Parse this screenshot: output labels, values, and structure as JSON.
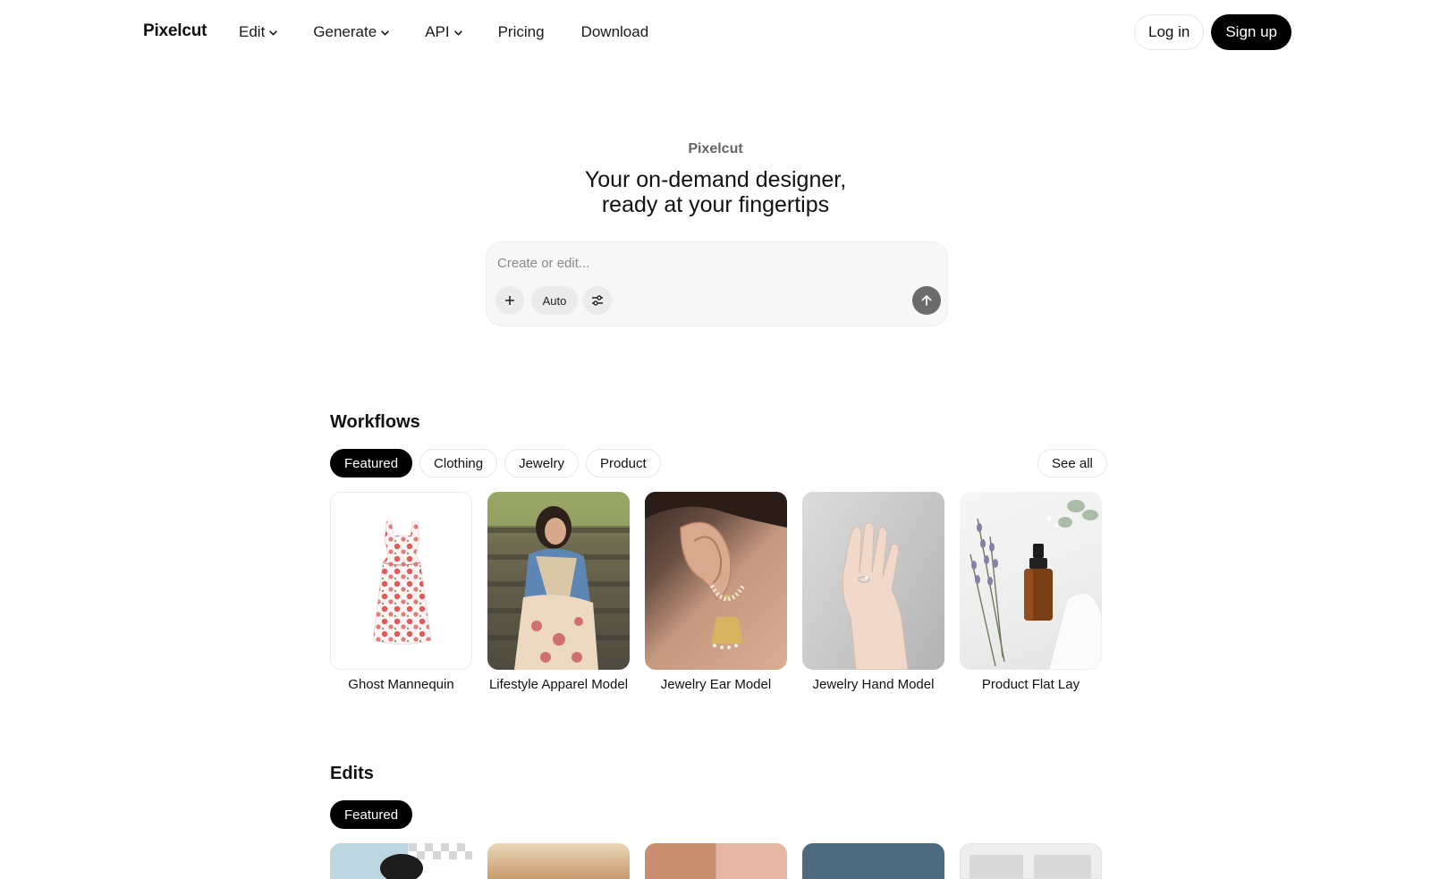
{
  "nav": {
    "brand": "Pixelcut",
    "links": [
      {
        "label": "Edit",
        "dropdown": true
      },
      {
        "label": "Generate",
        "dropdown": true
      },
      {
        "label": "API",
        "dropdown": true
      },
      {
        "label": "Pricing",
        "dropdown": false
      },
      {
        "label": "Download",
        "dropdown": false
      }
    ],
    "login_label": "Log in",
    "signup_label": "Sign up"
  },
  "hero": {
    "eyebrow": "Pixelcut",
    "title_line1": "Your on-demand designer,",
    "title_line2": "ready at your fingertips",
    "prompt_placeholder": "Create or edit...",
    "prompt_value": "",
    "auto_label": "Auto"
  },
  "workflows": {
    "title": "Workflows",
    "tabs": [
      {
        "label": "Featured",
        "active": true
      },
      {
        "label": "Clothing",
        "active": false
      },
      {
        "label": "Jewelry",
        "active": false
      },
      {
        "label": "Product",
        "active": false
      }
    ],
    "see_all_label": "See all",
    "cards": [
      {
        "label": "Ghost Mannequin",
        "image": "floral-dress-image"
      },
      {
        "label": "Lifestyle Apparel Model",
        "image": "woman-denim-jacket-image"
      },
      {
        "label": "Jewelry Ear Model",
        "image": "ear-earring-image"
      },
      {
        "label": "Jewelry Hand Model",
        "image": "hand-ring-image"
      },
      {
        "label": "Product Flat Lay",
        "image": "serum-bottle-lavender-image"
      }
    ]
  },
  "edits": {
    "title": "Edits",
    "tabs": [
      {
        "label": "Featured",
        "active": true
      }
    ]
  },
  "colors": {
    "accent": "#000000",
    "background": "#ffffff",
    "prompt_bg": "#f7f7f7",
    "send_button": "#6b6b6b"
  }
}
